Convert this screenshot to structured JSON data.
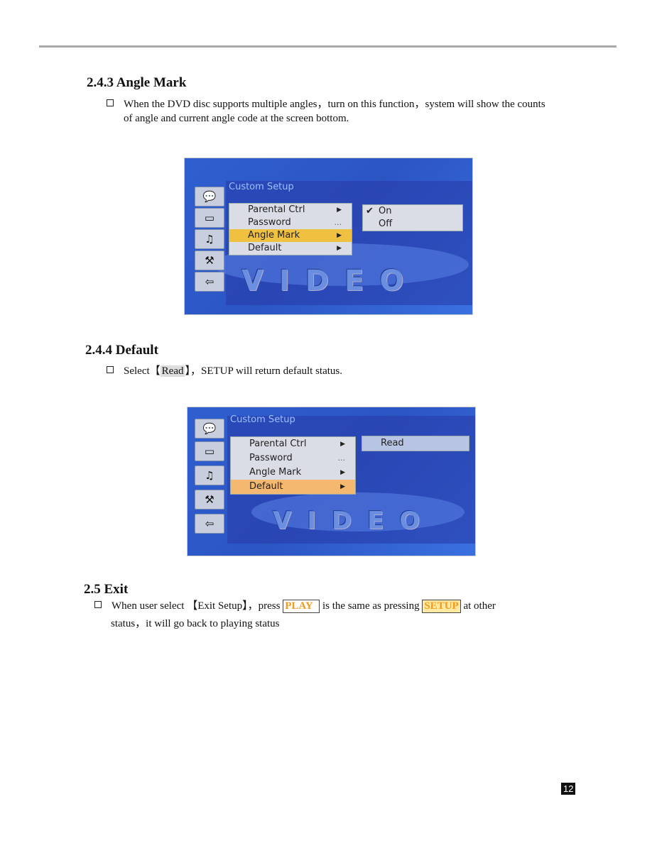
{
  "sections": {
    "angle_mark": {
      "heading": "2.4.3  Angle Mark",
      "text1": "When the DVD disc supports multiple angles，turn on this function，system will show the counts",
      "text2": "of angle and current angle code at the screen bottom."
    },
    "default": {
      "heading": "2.4.4   Default",
      "pre": "Select【",
      "key": "Read",
      "post": "】，SETUP will return default status."
    },
    "exit": {
      "heading": "2.5    Exit",
      "pre": "When user select  【Exit Setup】，press ",
      "key1": "PLAY",
      "mid": "  is the same as pressing ",
      "key2": "SETUP",
      "post": " at other",
      "line2": "status，it will go back to playing status"
    }
  },
  "screen1": {
    "title": "Custom  Setup",
    "menu": [
      "Parental  Ctrl",
      "Password",
      "Angle  Mark",
      "Default"
    ],
    "selected": "Angle  Mark",
    "submenu": [
      "On",
      "Off"
    ],
    "checked": "On",
    "bg_text": "VIDEO"
  },
  "screen2": {
    "title": "Custom  Setup",
    "menu": [
      "Parental  Ctrl",
      "Password",
      "Angle  Mark",
      "Default"
    ],
    "selected": "Default",
    "submenu": [
      "Read"
    ],
    "bg_text": "VIDEO"
  },
  "icons": [
    "language-icon",
    "tv-screen-icon",
    "audio-speaker-icon",
    "hammer-wrench-icon",
    "exit-door-icon"
  ],
  "page_number": "12"
}
